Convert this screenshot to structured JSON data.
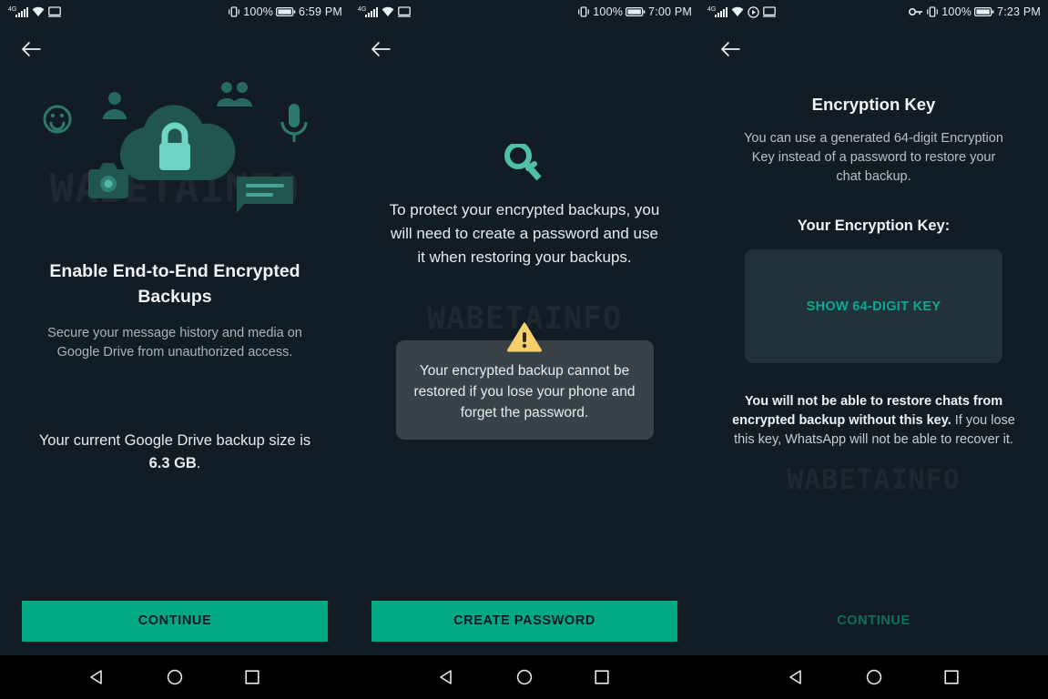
{
  "watermark": "WABETAINFO",
  "colors": {
    "background": "#121c24",
    "accent": "#00a884",
    "accent_dim": "#0f6f62",
    "card": "#22323a",
    "warn_box": "#3a4248",
    "warn_icon": "#f5cf6b",
    "illustration_light": "#6fd4c4",
    "illustration_dark": "#22584f"
  },
  "panels": [
    {
      "status_bar": {
        "network_label": "4G",
        "icons": [
          "signal-bars-icon",
          "wifi-icon",
          "cast-icon"
        ],
        "right_icons": [
          "vibrate-icon",
          "battery-icon"
        ],
        "battery": "100%",
        "time": "6:59 PM"
      },
      "back_label": "Back",
      "title": "Enable End-to-End Encrypted Backups",
      "subtitle": "Secure your message history and media on Google Drive from unauthorized access.",
      "backup_size_prefix": "Your current Google Drive backup size is ",
      "backup_size_value": "6.3 GB",
      "backup_size_suffix": ".",
      "button": "CONTINUE",
      "button_state": "enabled"
    },
    {
      "status_bar": {
        "network_label": "4G",
        "icons": [
          "signal-bars-icon",
          "wifi-icon",
          "cast-icon"
        ],
        "right_icons": [
          "vibrate-icon",
          "battery-icon"
        ],
        "battery": "100%",
        "time": "7:00 PM"
      },
      "back_label": "Back",
      "body": "To protect your encrypted backups, you will need to create a password and use it when restoring your backups.",
      "warning": "Your encrypted backup cannot be restored if you lose your phone and forget the password.",
      "button": "CREATE PASSWORD",
      "button_state": "enabled"
    },
    {
      "status_bar": {
        "network_label": "4G",
        "icons": [
          "signal-bars-icon",
          "wifi-icon",
          "play-circle-icon",
          "cast-icon"
        ],
        "right_icons": [
          "key-icon",
          "vibrate-icon",
          "battery-icon"
        ],
        "battery": "100%",
        "time": "7:23 PM"
      },
      "back_label": "Back",
      "title": "Encryption Key",
      "subtitle": "You can use a generated 64-digit Encryption Key instead of a password to restore your chat backup.",
      "key_label": "Your Encryption Key:",
      "show_key_button": "SHOW 64-DIGIT KEY",
      "warning_bold": "You will not be able to restore chats from encrypted backup without this key.",
      "warning_rest": " If you lose this key, WhatsApp will not be able to recover it.",
      "button": "CONTINUE",
      "button_state": "disabled"
    }
  ],
  "nav_bar": {
    "buttons": [
      "back-triangle-icon",
      "home-circle-icon",
      "recents-square-icon"
    ]
  }
}
